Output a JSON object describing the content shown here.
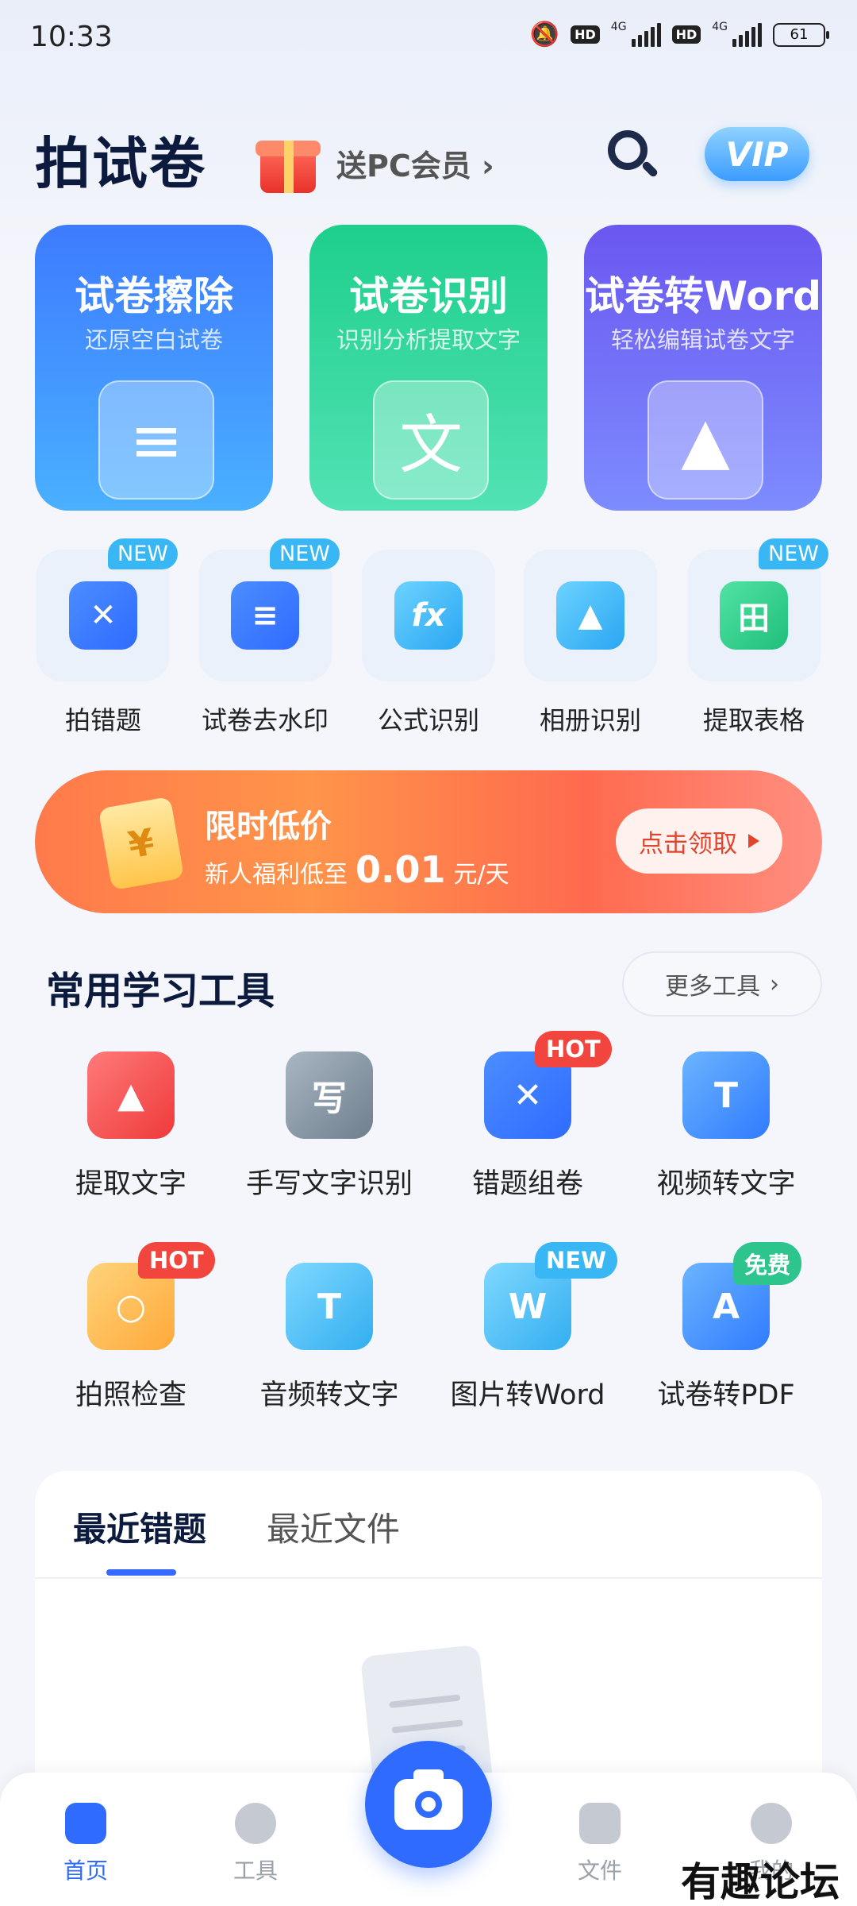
{
  "status_bar": {
    "time": "10:33",
    "hd1": "HD",
    "net1": "4G",
    "hd2": "HD",
    "net2": "4G",
    "battery": "61"
  },
  "header": {
    "title": "拍试卷",
    "promo": "送PC会员",
    "promo_chevron": "›",
    "vip": "VIP"
  },
  "feature_cards": [
    {
      "title": "试卷擦除",
      "subtitle": "还原空白试卷",
      "glyph": "≡",
      "color": "#3d7bff"
    },
    {
      "title": "试卷识别",
      "subtitle": "识别分析提取文字",
      "glyph": "文",
      "color": "#1ecf8c"
    },
    {
      "title": "试卷转Word",
      "subtitle": "轻松编辑试卷文字",
      "glyph": "▲",
      "color": "#6a57f0"
    }
  ],
  "quick_tools": [
    {
      "label": "拍错题",
      "badge": "NEW",
      "glyph": "✕"
    },
    {
      "label": "试卷去水印",
      "badge": "NEW",
      "glyph": "≡"
    },
    {
      "label": "公式识别",
      "badge": "",
      "glyph": "fx"
    },
    {
      "label": "相册识别",
      "badge": "",
      "glyph": "▲"
    },
    {
      "label": "提取表格",
      "badge": "NEW",
      "glyph": "田"
    }
  ],
  "banner": {
    "ticket_glyph": "¥",
    "title": "限时低价",
    "sub_prefix": "新人福利低至",
    "price": "0.01",
    "unit": "元/天",
    "cta": "点击领取"
  },
  "section": {
    "title": "常用学习工具",
    "more": "更多工具",
    "more_chevron": "›"
  },
  "tools": [
    {
      "label": "提取文字",
      "badge": "",
      "glyph": "▲"
    },
    {
      "label": "手写文字识别",
      "badge": "",
      "glyph": "写"
    },
    {
      "label": "错题组卷",
      "badge": "HOT",
      "glyph": "✕"
    },
    {
      "label": "视频转文字",
      "badge": "",
      "glyph": "T"
    },
    {
      "label": "拍照检查",
      "badge": "HOT",
      "glyph": "○"
    },
    {
      "label": "音频转文字",
      "badge": "",
      "glyph": "T"
    },
    {
      "label": "图片转Word",
      "badge": "NEW",
      "glyph": "W"
    },
    {
      "label": "试卷转PDF",
      "badge": "免费",
      "glyph": "A"
    }
  ],
  "recent": {
    "tab1": "最近错题",
    "tab2": "最近文件"
  },
  "bottom_nav": {
    "home": "首页",
    "tools": "工具",
    "files": "文件",
    "mine": "我的"
  },
  "watermark": "有趣论坛",
  "colors": {
    "accent": "#2f6bff",
    "title": "#0c1a3d",
    "hot": "#f2453d",
    "new": "#39b7f5",
    "free": "#2ec48e"
  }
}
